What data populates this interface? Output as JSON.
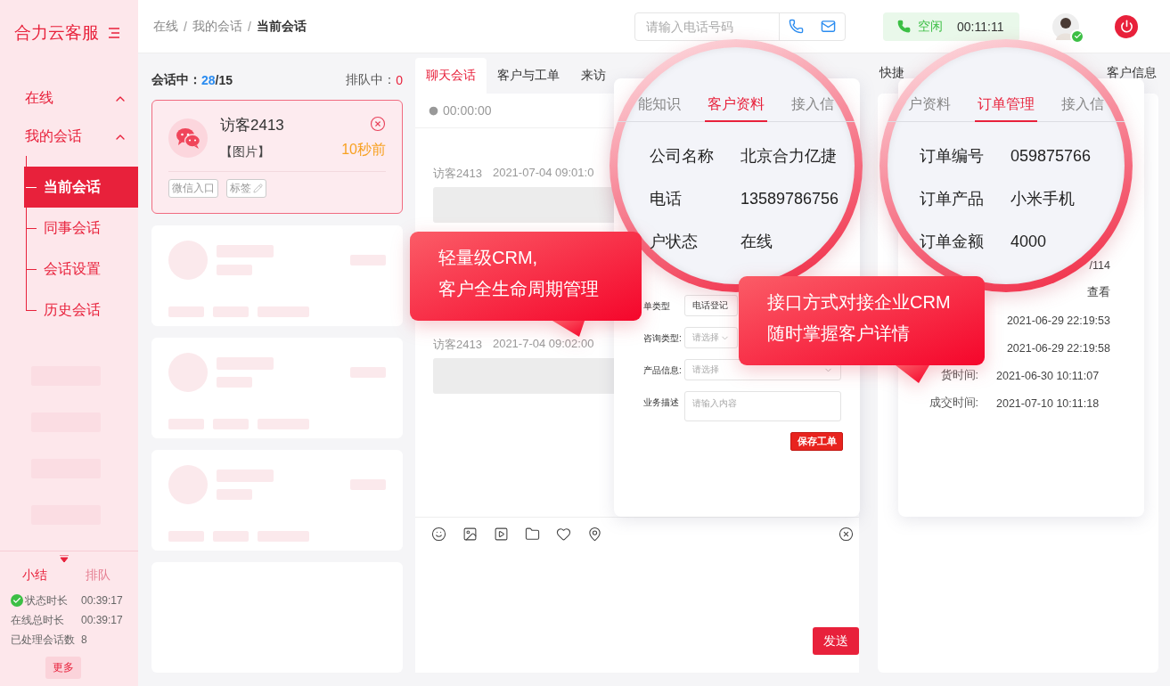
{
  "sidebar": {
    "logo": "合力云客服",
    "nav": [
      {
        "label": "在线",
        "expanded": true
      },
      {
        "label": "我的会话",
        "expanded": true,
        "children": [
          {
            "label": "当前会话",
            "selected": true
          },
          {
            "label": "同事会话",
            "selected": false
          },
          {
            "label": "会话设置",
            "selected": false
          },
          {
            "label": "历史会话",
            "selected": false
          }
        ]
      }
    ],
    "summary_tabs": [
      {
        "label": "小结",
        "selected": true
      },
      {
        "label": "排队",
        "selected": false
      }
    ],
    "stats": [
      {
        "label": "状态时长",
        "value": "00:39:17",
        "checked": true
      },
      {
        "label": "在线总时长",
        "value": "00:39:17",
        "checked": false
      },
      {
        "label": "已处理会话数",
        "value": "8",
        "checked": false
      }
    ],
    "more_button": "更多"
  },
  "topbar": {
    "breadcrumb": [
      "在线",
      "我的会话",
      "当前会话"
    ],
    "breadcrumb_separator": "/",
    "phone_field": {
      "placeholder": "请输入电话号码"
    },
    "status": {
      "label": "空闲",
      "timer": "00:11:11"
    }
  },
  "sessions": {
    "in_session_label": "会话中：",
    "in_session": "28",
    "capacity": "/15",
    "queue_label": "排队中：",
    "queue": "0",
    "cards": [
      {
        "kind": "visitor",
        "name": "访客2413",
        "message": "【图片】",
        "time": "10秒前",
        "tags": [
          "微信入口",
          "标签"
        ],
        "selected": true
      },
      {
        "kind": "placeholder"
      },
      {
        "kind": "placeholder"
      },
      {
        "kind": "placeholder"
      },
      {
        "kind": "empty"
      }
    ]
  },
  "chat": {
    "tabs": [
      {
        "label": "聊天会话",
        "selected": true
      },
      {
        "label": "客户与工单",
        "selected": false
      },
      {
        "label": "来访",
        "selected": false
      }
    ],
    "timer": "00:00:00",
    "messages": [
      {
        "sender": "访客2413",
        "time": "2021-07-04 09:01:0"
      },
      {
        "sender": "访客2413",
        "time": "2021-7-04 09:02:00"
      }
    ],
    "send_button": "发送"
  },
  "side_panel": {
    "title": "快捷",
    "title_right": "客户信息"
  },
  "work_order": {
    "fields": [
      {
        "kind": "input",
        "label": "单类型",
        "value": "电话登记"
      },
      {
        "kind": "select",
        "label": "咨询类型:",
        "placeholder": "请选择"
      },
      {
        "kind": "select",
        "label": "产品信息:",
        "placeholder": "请选择"
      },
      {
        "kind": "textarea",
        "label": "业务描述",
        "placeholder": "请输入内容"
      }
    ],
    "save_button": "保存工单"
  },
  "order_details": {
    "rows": [
      {
        "value": "/114"
      },
      {
        "value": "查看"
      },
      {
        "value": "2021-06-29 22:19:53"
      },
      {
        "value": "2021-06-29 22:19:58"
      },
      {
        "label": "货时间:",
        "value": "2021-06-30 10:11:07"
      },
      {
        "label": "成交时间:",
        "value": "2021-07-10 10:11:18"
      }
    ]
  },
  "magnifiers": [
    {
      "tabs": [
        {
          "label": "能知识",
          "selected": false
        },
        {
          "label": "客户资料",
          "selected": true
        },
        {
          "label": "接入信",
          "selected": false
        }
      ],
      "rows": [
        {
          "label": "公司名称",
          "value": "北京合力亿捷"
        },
        {
          "label": "电话",
          "value": "13589786756"
        },
        {
          "label": "户状态",
          "value": "在线"
        }
      ]
    },
    {
      "tabs": [
        {
          "label": "户资料",
          "selected": false
        },
        {
          "label": "订单管理",
          "selected": true
        },
        {
          "label": "接入信",
          "selected": false
        }
      ],
      "rows": [
        {
          "label": "订单编号",
          "value": "059875766"
        },
        {
          "label": "订单产品",
          "value": "小米手机"
        },
        {
          "label": "订单金额",
          "value": "4000"
        }
      ]
    }
  ],
  "callouts": [
    {
      "lines": [
        "轻量级CRM,",
        "客户全生命周期管理"
      ]
    },
    {
      "lines": [
        "接口方式对接企业CRM",
        "随时掌握客户详情"
      ]
    }
  ]
}
